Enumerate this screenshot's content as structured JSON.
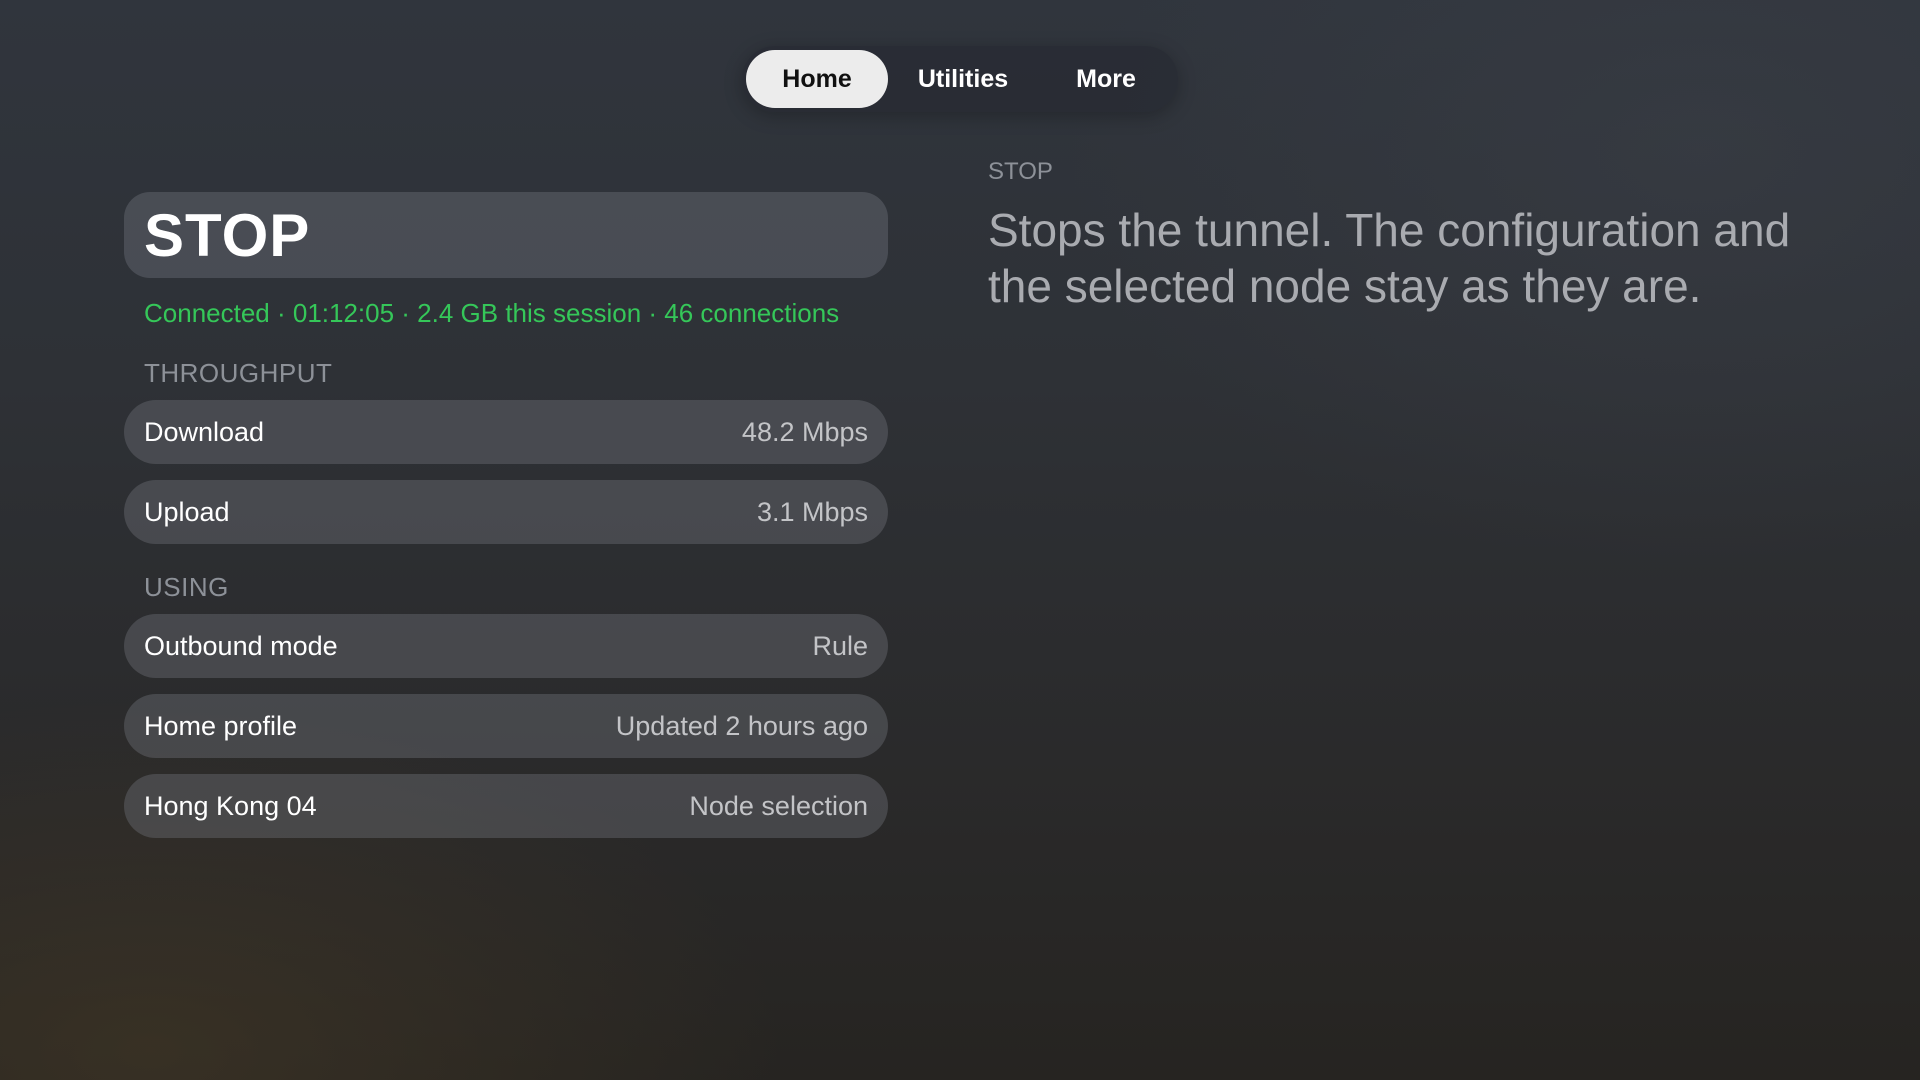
{
  "tabs": [
    {
      "label": "Home",
      "selected": true
    },
    {
      "label": "Utilities",
      "selected": false
    },
    {
      "label": "More",
      "selected": false
    }
  ],
  "main": {
    "stop_button_label": "STOP",
    "status_line": "Connected · 01:12:05 · 2.4 GB this session · 46 connections",
    "throughput": {
      "header": "THROUGHPUT",
      "rows": [
        {
          "label": "Download",
          "value": "48.2 Mbps"
        },
        {
          "label": "Upload",
          "value": "3.1 Mbps"
        }
      ]
    },
    "using": {
      "header": "USING",
      "rows": [
        {
          "label": "Outbound mode",
          "value": "Rule"
        },
        {
          "label": "Home profile",
          "value": "Updated 2 hours ago"
        },
        {
          "label": "Hong Kong 04",
          "value": "Node selection"
        }
      ]
    }
  },
  "description": {
    "title": "STOP",
    "text": "Stops the tunnel. The configuration and the selected node stay as they are."
  },
  "colors": {
    "status_green": "#35c759",
    "selected_tab_bg": "#ececec"
  }
}
